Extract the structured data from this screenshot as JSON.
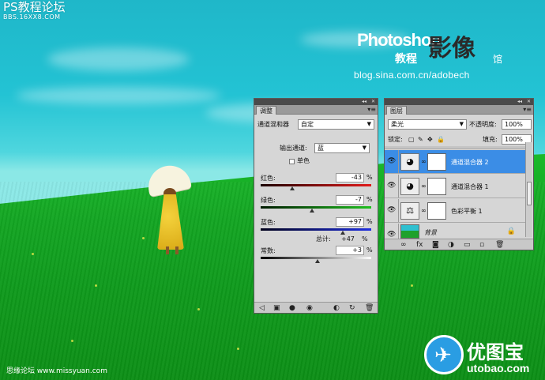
{
  "watermarks": {
    "top_left_title": "PS教程论坛",
    "top_left_sub": "BBS.16XX8.COM",
    "ps_logo": "Photoshop",
    "ps_logo_big": "影像",
    "ps_logo_small": "教程",
    "ps_logo_end": "馆",
    "blog": "blog.sina.com.cn/adobech",
    "bottom_left": "思缘论坛  www.missyuan.com",
    "brand_zh": "优图宝",
    "brand_en": "utobao.com"
  },
  "adjust_panel": {
    "tab": "调整",
    "title": "通道混和器",
    "preset": "自定",
    "output_label": "输出通道:",
    "output_value": "蓝",
    "mono_label": "单色",
    "mono_checked": false,
    "sliders": [
      {
        "label": "红色:",
        "value": "-43",
        "fraction": 0.285,
        "gradient": "linear-gradient(90deg,#1a0000,#e21a1a)"
      },
      {
        "label": "绿色:",
        "value": "-7",
        "fraction": 0.465,
        "gradient": "linear-gradient(90deg,#001a00,#20c020)"
      },
      {
        "label": "蓝色:",
        "value": "+97",
        "fraction": 0.74,
        "gradient": "linear-gradient(90deg,#00001a,#2030e0)"
      }
    ],
    "total_label": "总计:",
    "total_value": "+47",
    "total_unit": "%",
    "const_label": "常数:",
    "const_value": "+3",
    "const_fraction": 0.515,
    "pct": "%"
  },
  "layers_panel": {
    "tab": "图层",
    "blend_mode": "柔光",
    "opacity_label": "不透明度:",
    "opacity_value": "100%",
    "lock_label": "锁定:",
    "fill_label": "填充:",
    "fill_value": "100%",
    "layers": [
      {
        "name": "通道混合器 2",
        "selected": true,
        "icon": "channel-mixer-icon"
      },
      {
        "name": "通道混合器 1",
        "selected": false,
        "icon": "channel-mixer-icon"
      },
      {
        "name": "色彩平衡 1",
        "selected": false,
        "icon": "color-balance-icon"
      },
      {
        "name": "背景",
        "selected": false,
        "icon": "background"
      }
    ]
  }
}
